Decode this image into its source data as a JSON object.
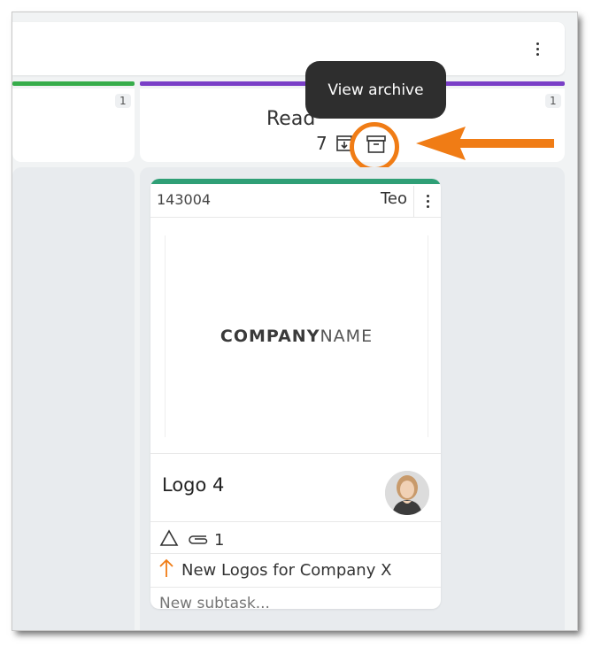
{
  "colors": {
    "accent_orange": "#f07c15",
    "column_left_strip": "#37ad4b",
    "column_right_strip": "#7a3fc7",
    "card_strip": "#2f9f76",
    "tooltip_bg": "#2e2e2e"
  },
  "columns": [
    {
      "badge": "1"
    },
    {
      "title": "Read",
      "badge": "1",
      "archived_count": "7"
    }
  ],
  "tooltip": {
    "text": "View archive"
  },
  "card": {
    "id": "143004",
    "assignee": "Teo",
    "image": {
      "brand_bold": "COMPANY",
      "brand_light": "NAME"
    },
    "name": "Logo 4",
    "attachments": "1",
    "parent": "New Logos for Company X",
    "subtask_placeholder": "New subtask..."
  },
  "icons": [
    "kebab-menu-icon",
    "download-archive-icon",
    "archive-box-icon",
    "warning-triangle-icon",
    "paperclip-icon",
    "arrow-up-icon",
    "pointer-arrow-icon"
  ]
}
